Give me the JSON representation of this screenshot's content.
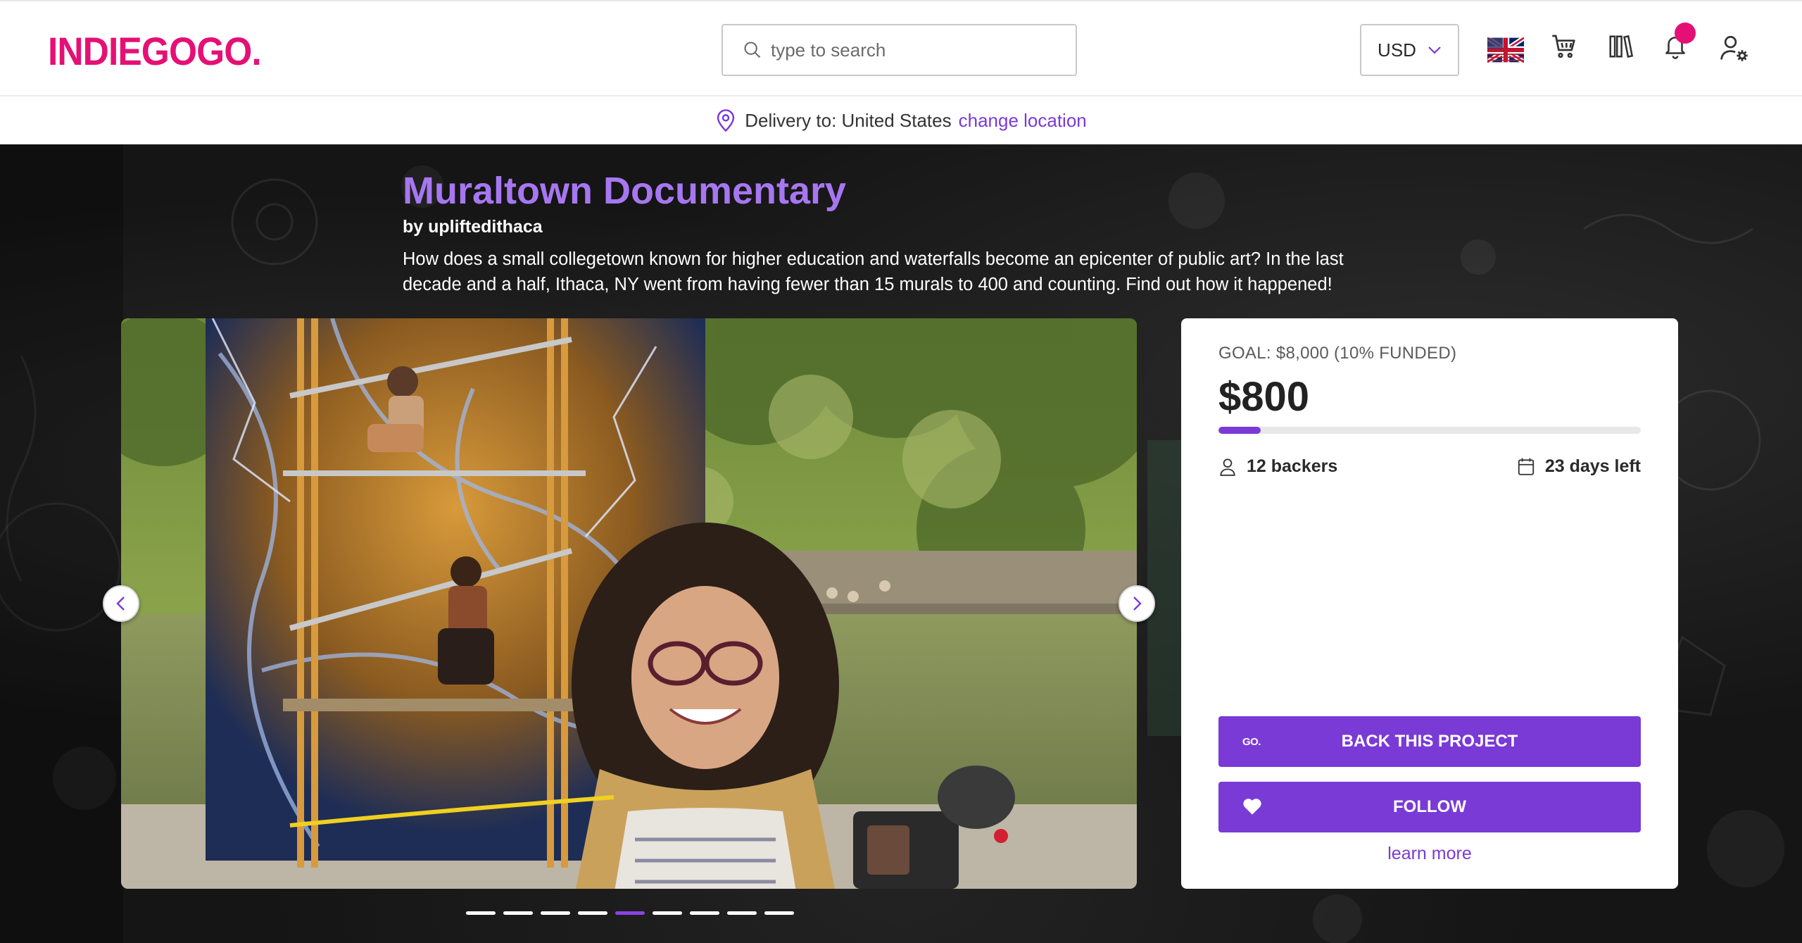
{
  "header": {
    "logo_text": "INDIEGOGO",
    "logo_dot": ".",
    "search_placeholder": "type to search",
    "currency": "USD",
    "icons": {
      "flag": "uk-flag-icon",
      "cart": "cart-icon",
      "library": "library-icon",
      "bell": "bell-icon",
      "account": "account-settings-icon"
    }
  },
  "delivery": {
    "label": "Delivery to: United States",
    "change_link": "change location"
  },
  "campaign": {
    "title": "Muraltown Documentary",
    "byline": "by upliftedithaca",
    "blurb": "How does a small collegetown known for higher education and waterfalls become an epicenter of public art? In the last decade and a half, Ithaca, NY went from having fewer than 15 murals to 400 and counting. Find out how it happened!"
  },
  "gallery": {
    "slide_count": 9,
    "active_slide": 5
  },
  "funding": {
    "goal_text": "GOAL: $8,000 (10% FUNDED)",
    "raised": "$800",
    "progress_fraction": 0.1,
    "backers": "12 backers",
    "days_left": "23 days left",
    "back_button": "BACK THIS PROJECT",
    "back_button_badge": "GO.",
    "follow_button": "FOLLOW",
    "learn_more": "learn more"
  },
  "colors": {
    "brand": "#e51075",
    "accent": "#7a3ad6",
    "title": "#a677f0"
  }
}
